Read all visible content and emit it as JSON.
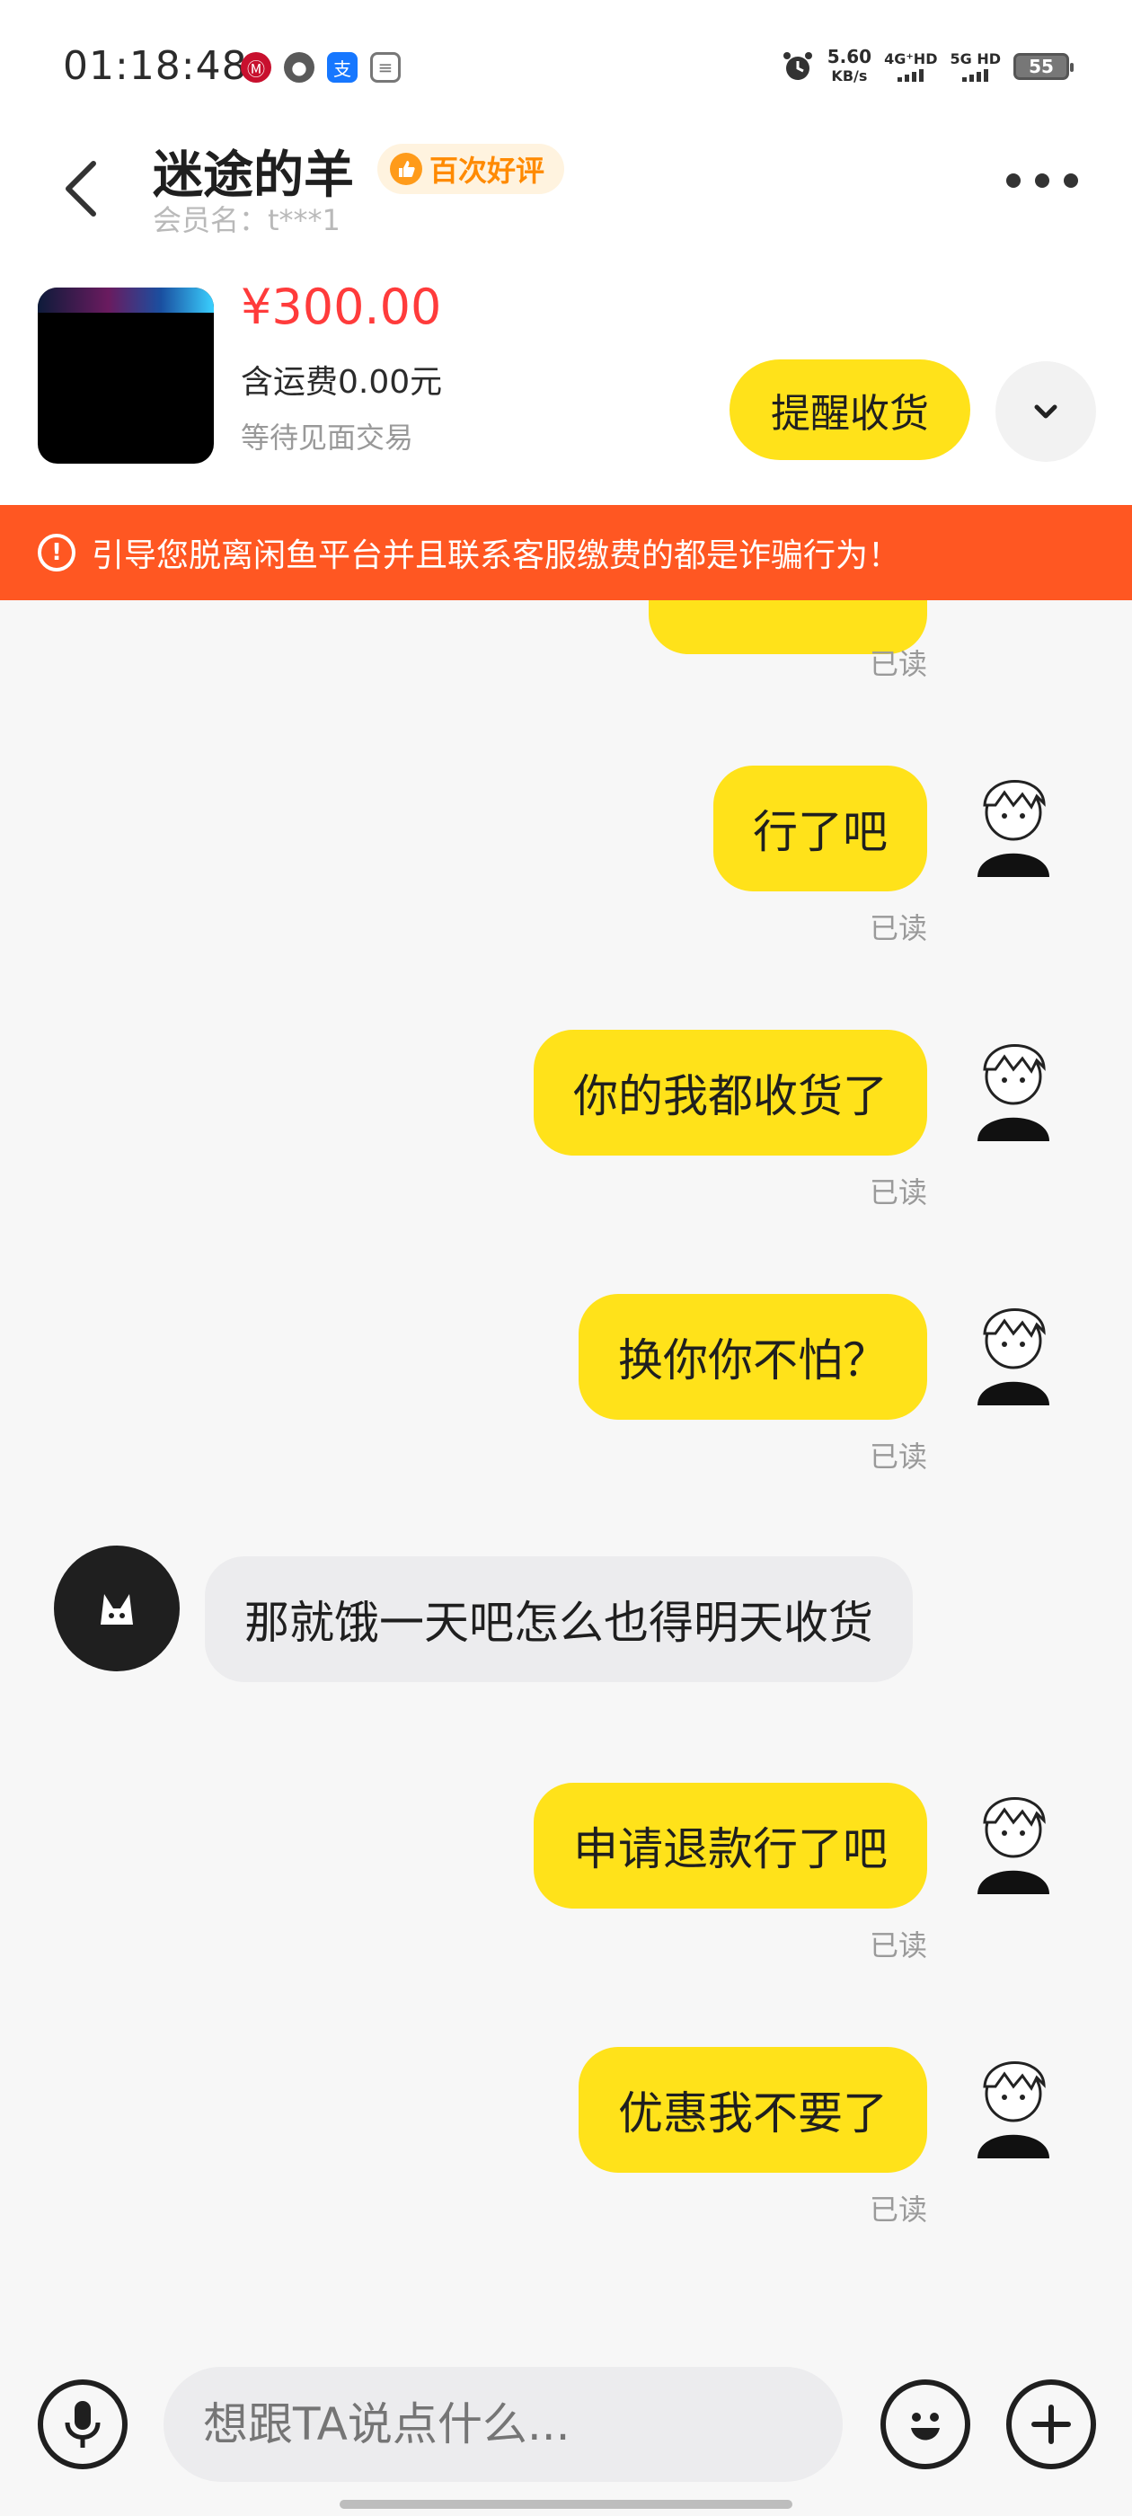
{
  "status_bar": {
    "time": "01:18:48",
    "speed_value": "5.60",
    "speed_unit": "KB/s",
    "net1": "4G⁺HD",
    "net2": "5G HD",
    "battery": "55"
  },
  "header": {
    "seller_name": "迷途的羊",
    "badge": "百次好评",
    "member": "会员名：t***1"
  },
  "product": {
    "price": "¥300.00",
    "shipping": "含运费0.00元",
    "status": "等待见面交易",
    "remind_label": "提醒收货"
  },
  "warning": {
    "text": "引导您脱离闲鱼平台并且联系客服缴费的都是诈骗行为！"
  },
  "messages": [
    {
      "from": "me",
      "text": "行了吧",
      "status": "已读"
    },
    {
      "from": "me",
      "text": "你的我都收货了",
      "status": "已读"
    },
    {
      "from": "me",
      "text": "换你你不怕？",
      "status": "已读"
    },
    {
      "from": "other",
      "text": "那就饿一天吧怎么也得明天收货"
    },
    {
      "from": "me",
      "text": "申请退款行了吧",
      "status": "已读"
    },
    {
      "from": "me",
      "text": "优惠我不要了",
      "status": "已读"
    }
  ],
  "partial_read": "已读",
  "input": {
    "placeholder": "想跟TA说点什么..."
  },
  "colors": {
    "accent_yellow": "#ffe21a",
    "price_red": "#ff3b3b",
    "warning_orange": "#ff5722"
  }
}
